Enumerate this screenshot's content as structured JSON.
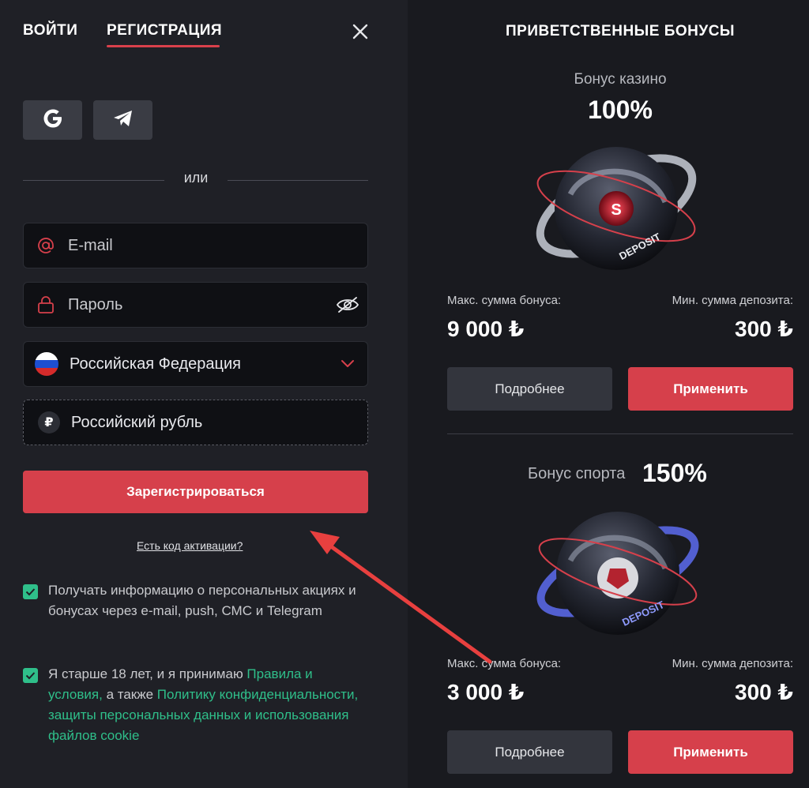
{
  "tabs": {
    "login": "ВОЙТИ",
    "register": "РЕГИСТРАЦИЯ"
  },
  "social": {
    "google_icon": "google-icon",
    "telegram_icon": "telegram-icon"
  },
  "separator": "или",
  "form": {
    "email_placeholder": "E-mail",
    "password_placeholder": "Пароль",
    "country": "Российская Федерация",
    "currency": "Российский рубль",
    "currency_symbol": "₽",
    "submit": "Зарегистрироваться",
    "activation_link": "Есть код активации?"
  },
  "consents": {
    "marketing": "Получать информацию о персональных акциях и бонусах через e-mail, push, СМС и Telegram",
    "age_prefix": "Я старше 18 лет, и я принимаю ",
    "terms_link": "Правила и условия,",
    "age_middle": " а также ",
    "privacy_link": "Политику конфиденциальности, защиты персональных данных и использования файлов cookie"
  },
  "bonuses": {
    "title": "ПРИВЕТСТВЕННЫЕ БОНУСЫ",
    "casino": {
      "label": "Бонус казино",
      "percent": "100%",
      "max_label": "Макс. сумма бонуса:",
      "max_value": "9 000 ₺",
      "min_label": "Мин. сумма депозита:",
      "min_value": "300 ₺",
      "more": "Подробнее",
      "apply": "Применить"
    },
    "sport": {
      "label": "Бонус спорта",
      "percent": "150%",
      "max_label": "Макс. сумма бонуса:",
      "max_value": "3 000 ₺",
      "min_label": "Мин. сумма депозита:",
      "min_value": "300 ₺",
      "more": "Подробнее",
      "apply": "Применить"
    },
    "orb_text": "DEPOSIT"
  },
  "colors": {
    "accent": "#d6404b",
    "check": "#2fbf8a",
    "link": "#2fbf8a"
  }
}
